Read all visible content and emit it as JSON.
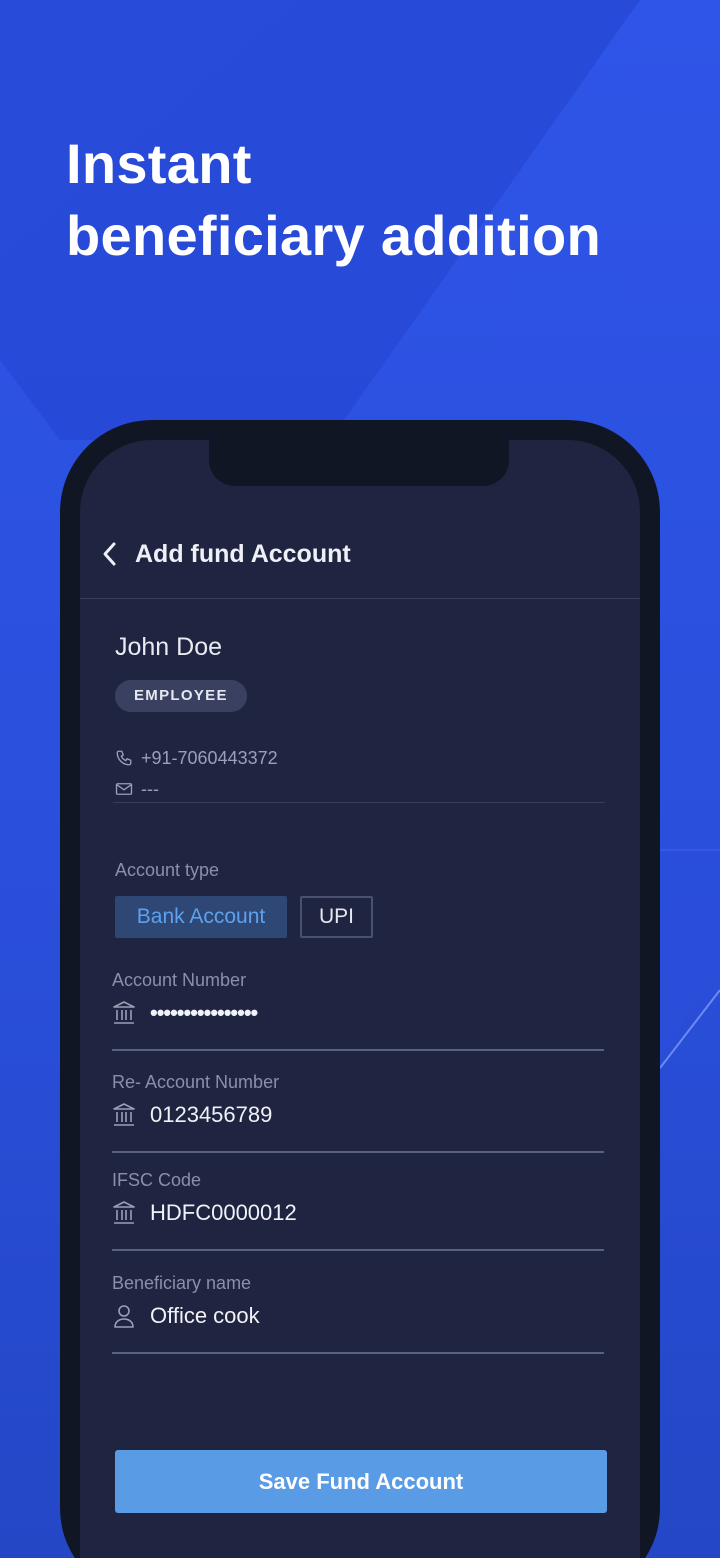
{
  "hero": {
    "title_line1": "Instant",
    "title_line2": "beneficiary addition"
  },
  "header": {
    "back_icon": "chevron-left-icon",
    "title": "Add fund Account"
  },
  "profile": {
    "name": "John Doe",
    "badge": "EMPLOYEE",
    "phone_icon": "phone-icon",
    "phone": "+91-7060443372",
    "email_icon": "mail-icon",
    "email": "---"
  },
  "account_type": {
    "label": "Account type",
    "options": [
      "Bank Account",
      "UPI"
    ],
    "selected": "Bank Account"
  },
  "fields": [
    {
      "label": "Account Number",
      "value": "••••••••••••••••",
      "icon": "bank-icon"
    },
    {
      "label": "Re- Account Number",
      "value": "0123456789",
      "icon": "bank-icon"
    },
    {
      "label": "IFSC Code",
      "value": "HDFC0000012",
      "icon": "bank-icon"
    },
    {
      "label": "Beneficiary name",
      "value": "Office cook",
      "icon": "user-icon"
    }
  ],
  "actions": {
    "save_label": "Save Fund Account"
  },
  "colors": {
    "background": "#2f55e8",
    "phone_screen": "#1f2440",
    "accent": "#5a9be6",
    "selected_tab_text": "#5ea1ef"
  }
}
